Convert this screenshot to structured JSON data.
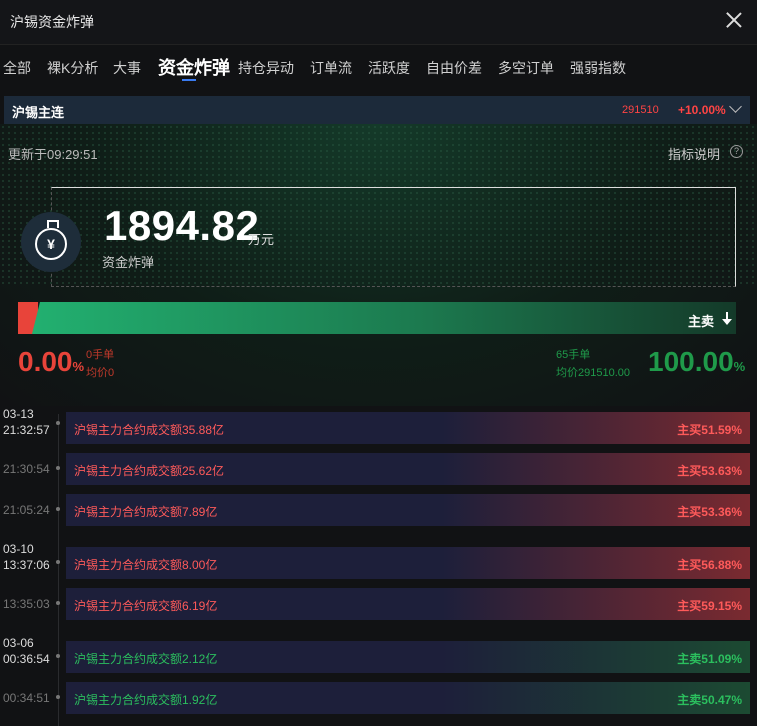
{
  "window": {
    "title": "沪锡资金炸弹"
  },
  "tabs": [
    "全部",
    "裸K分析",
    "大事",
    "资金炸弹",
    "持仓异动",
    "订单流",
    "活跃度",
    "自由价差",
    "多空订单",
    "强弱指数"
  ],
  "contract": {
    "name": "沪锡主连",
    "code": "291510",
    "change": "+10.00%"
  },
  "update_time": "更新于09:29:51",
  "help_label": "指标说明",
  "help_icon": "?",
  "coin_symbol": "¥",
  "bomb": {
    "amount": "1894.82",
    "unit": "万元",
    "label": "资金炸弹"
  },
  "bar": {
    "label": "主卖",
    "buy_ratio": 0.0,
    "sell_ratio": 1.0
  },
  "buy": {
    "pct": "0.00",
    "pct_sign": "%",
    "lots": "0手单",
    "avg": "均价0"
  },
  "sell": {
    "pct": "100.00",
    "pct_sign": "%",
    "lots": "65手单",
    "avg": "均价291510.00"
  },
  "events": [
    {
      "date": "03-13",
      "time": "21:32:57",
      "desc": "沪锡主力合约成交额35.88亿",
      "side": "主买51.59%",
      "type": "buy"
    },
    {
      "date": "",
      "time": "21:30:54",
      "desc": "沪锡主力合约成交额25.62亿",
      "side": "主买53.63%",
      "type": "buy"
    },
    {
      "date": "",
      "time": "21:05:24",
      "desc": "沪锡主力合约成交额7.89亿",
      "side": "主买53.36%",
      "type": "buy"
    },
    {
      "date": "03-10",
      "time": "13:37:06",
      "desc": "沪锡主力合约成交额8.00亿",
      "side": "主买56.88%",
      "type": "buy"
    },
    {
      "date": "",
      "time": "13:35:03",
      "desc": "沪锡主力合约成交额6.19亿",
      "side": "主买59.15%",
      "type": "buy"
    },
    {
      "date": "03-06",
      "time": "00:36:54",
      "desc": "沪锡主力合约成交额2.12亿",
      "side": "主卖51.09%",
      "type": "sell"
    },
    {
      "date": "",
      "time": "00:34:51",
      "desc": "沪锡主力合约成交额1.92亿",
      "side": "主卖50.47%",
      "type": "sell"
    }
  ]
}
